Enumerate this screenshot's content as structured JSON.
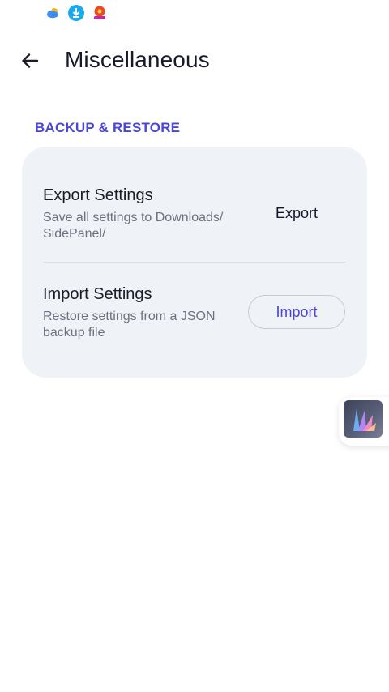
{
  "status_bar": {
    "icons": [
      "weather-icon",
      "download-icon",
      "app-notification-icon"
    ]
  },
  "header": {
    "back_icon": "arrow-back-icon",
    "title": "Miscellaneous"
  },
  "section": {
    "title": "BACKUP & RESTORE",
    "accent_color": "#4b46d6"
  },
  "export": {
    "title": "Export Settings",
    "description": "Save all settings to Downloads/ SidePanel/",
    "button_label": "Export"
  },
  "import": {
    "title": "Import Settings",
    "description": "Restore settings from a JSON backup file",
    "button_label": "Import"
  },
  "side_panel": {
    "icon": "side-panel-app-icon"
  }
}
